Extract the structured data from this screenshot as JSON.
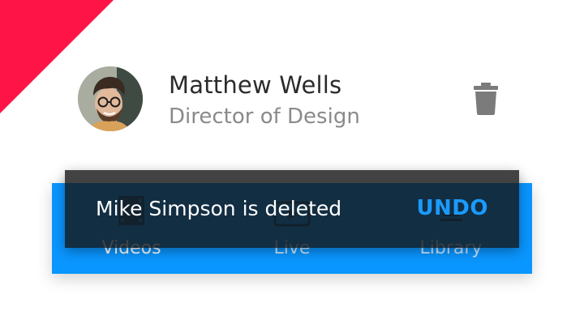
{
  "contact": {
    "name": "Matthew Wells",
    "title": "Director of Design",
    "avatar_icon": "avatar-photo",
    "delete_icon": "trash-icon"
  },
  "bottom_nav": {
    "items": [
      {
        "label": "Videos",
        "icon": "film-icon"
      },
      {
        "label": "Live",
        "icon": "live-play-icon"
      },
      {
        "label": "Library",
        "icon": "library-icon"
      }
    ]
  },
  "snackbar": {
    "message": "Mike Simpson is deleted",
    "action_label": "UNDO"
  },
  "colors": {
    "accent_corner": "#ff1447",
    "nav_background": "#0a96ff",
    "action": "#1a9bff",
    "snackbar_background": "#141414"
  }
}
